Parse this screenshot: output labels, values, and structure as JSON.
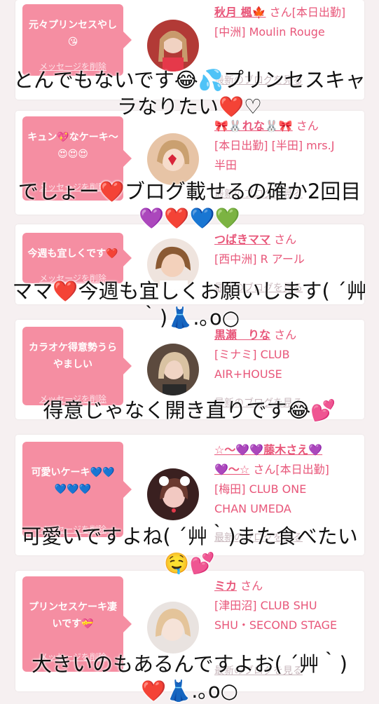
{
  "cards": [
    {
      "bubble_text": "元々プリンセスやし😘",
      "delete_label": "メッセージを削除",
      "name": "秋月 楓🍁",
      "suffix": "さん[本日出勤]",
      "shop": "[中洲] Moulin Rouge",
      "blog_label": "最新のブログを見る",
      "overlay": "とんでもないです😂💦プリンセスキャラなりたい❤️♡"
    },
    {
      "bubble_text": "キュン💖なケーキ〜😍😍😍",
      "delete_label": "メッセージを削除",
      "name": "🎀🐰れな🐰🎀",
      "suffix": "さん",
      "shop": "[本日出勤] [半田] mrs.J 半田",
      "blog_label": "最新のブログを見る",
      "overlay": "でしょー❤️ブログ載せるの確か2回目💜❤️💙💚"
    },
    {
      "bubble_text": "今週も宜しくです❤️",
      "delete_label": "メッセージを削除",
      "name": "つばきママ",
      "suffix": "さん",
      "shop": "[西中洲] R アール",
      "blog_label": "最新のブログを見る",
      "overlay": "ママ❤️今週も宜しくお願いします( ´艸｀)👗.｡o○"
    },
    {
      "bubble_text": "カラオケ得意勢うらやましい",
      "delete_label": "メッセージを削除",
      "name": "黒瀬　りな",
      "suffix": "さん",
      "shop": "[ミナミ] CLUB AIR+HOUSE",
      "blog_label": "最新のブログを見る",
      "overlay": "得意じゃなく開き直りです😂💕"
    },
    {
      "bubble_text": "可愛いケーキ💙💙💙💙💙",
      "delete_label": "メッセージを削除",
      "name": "☆〜💜💜藤木さえ💜💜〜☆",
      "suffix": "さん[本日出勤]",
      "shop": "[梅田] CLUB ONE CHAN UMEDA",
      "blog_label": "最新のブログを見る",
      "overlay": "可愛いですよね( ´艸｀)また食べたい🤤💕"
    },
    {
      "bubble_text": "プリンセスケーキ凄いです💝",
      "delete_label": "メッセージを削除",
      "name": "ミカ",
      "suffix": "さん",
      "shop": "[津田沼] CLUB SHU SHU・SECOND STAGE",
      "blog_label": "最新のブログを見る",
      "overlay": "大きいのもあるんですよお( ´艸｀)❤️👗.｡o○"
    }
  ],
  "colors": {
    "bubble": "#f58ea2",
    "accent_text": "#e8577a",
    "muted_link": "#c8b7bc",
    "page_bg": "#f6f0f1"
  }
}
